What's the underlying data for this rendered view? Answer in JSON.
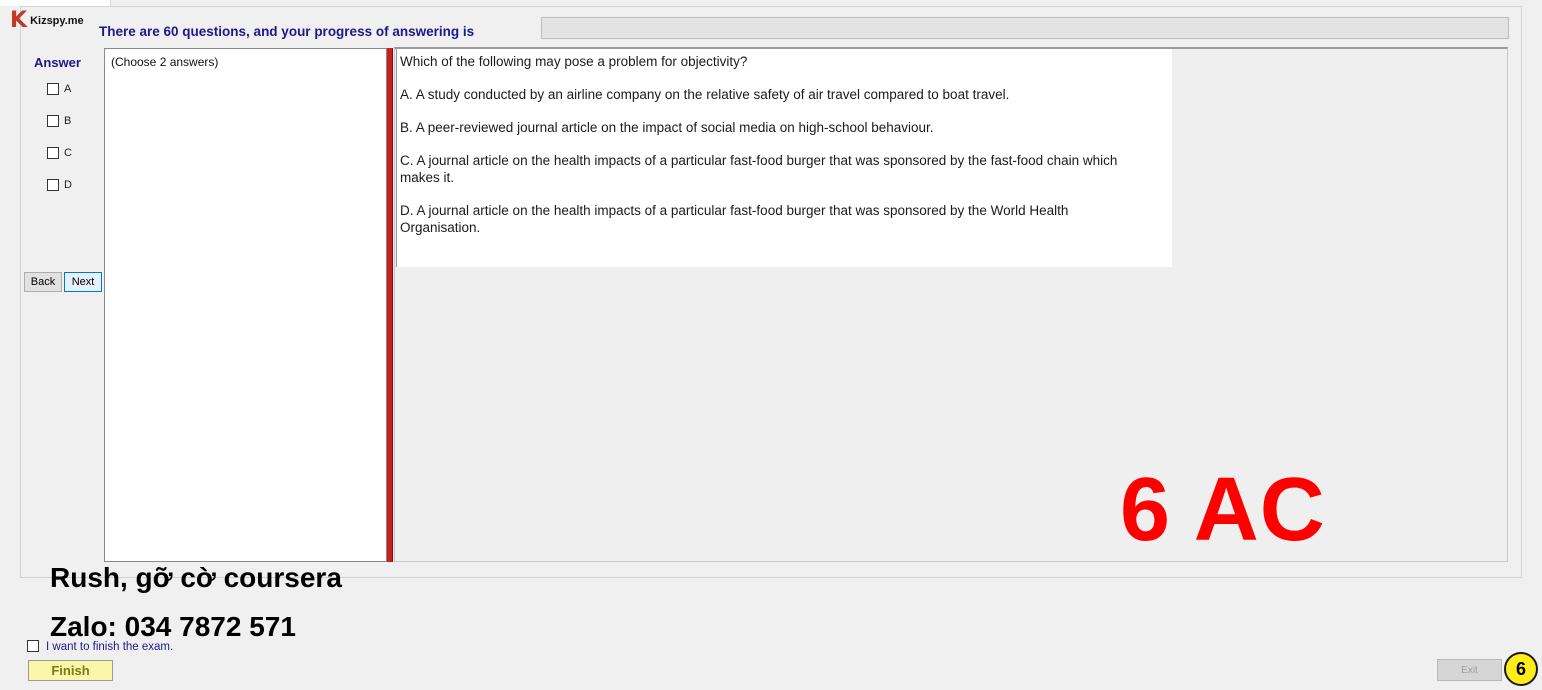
{
  "brand": {
    "logo_letter": "K",
    "name": "Kizspy.me"
  },
  "header": {
    "title": "There are 60 questions, and your progress of answering is",
    "progress_fraction": 0
  },
  "answer_panel": {
    "heading": "Answer",
    "options": [
      {
        "label": "A",
        "checked": false
      },
      {
        "label": "B",
        "checked": false
      },
      {
        "label": "C",
        "checked": false
      },
      {
        "label": "D",
        "checked": false
      }
    ],
    "back_label": "Back",
    "next_label": "Next"
  },
  "instruction": "(Choose 2 answers)",
  "question": {
    "stem": "Which of the following may pose a problem for objectivity?",
    "choices": [
      "A.  A study conducted by an airline company on the relative safety of air travel compared to boat travel.",
      "B.  A peer-reviewed journal article on the impact of social media on high-school behaviour.",
      "C.  A journal article on the health impacts of a particular fast-food burger that was sponsored by the fast-food chain which makes it.",
      "D.  A journal article on the health impacts of a particular fast-food burger that was sponsored by the World Health Organisation."
    ]
  },
  "overlay": {
    "answer_stamp": "6 AC",
    "watermark_line1": "Rush, gỡ cờ coursera",
    "watermark_line2": "Zalo: 034 7872 571",
    "badge_number": "6"
  },
  "footer": {
    "finish_checkbox_label": "I want to finish the exam.",
    "finish_label": "Finish",
    "exit_label": "Exit"
  },
  "colors": {
    "accent": "#1a1a8c",
    "divider": "#cc1e1e",
    "stamp": "#ff0000",
    "badge": "#ffec1a",
    "finish_bg": "#f8f8a8"
  }
}
